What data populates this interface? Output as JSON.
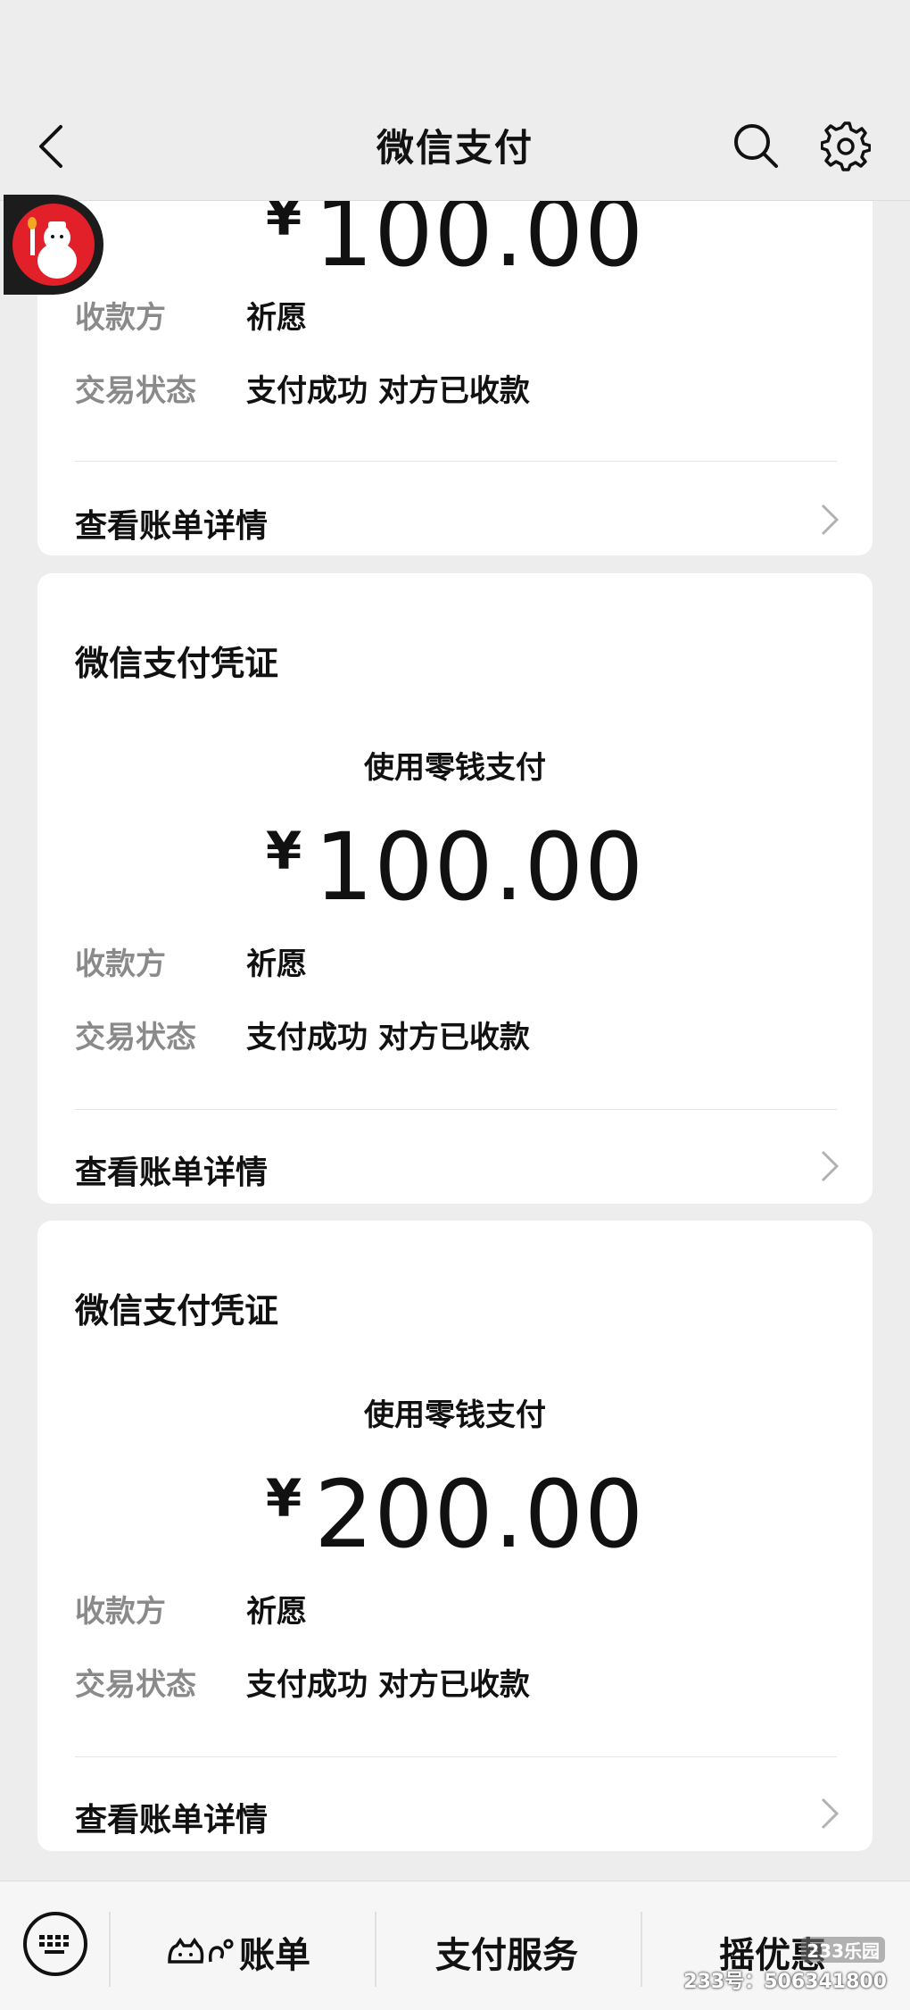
{
  "header": {
    "title": "微信支付"
  },
  "cards": [
    {
      "title": "",
      "method": "",
      "currency": "¥",
      "amount": "100.00",
      "payee_label": "收款方",
      "payee": "祈愿",
      "status_label": "交易状态",
      "status": "支付成功 对方已收款",
      "detail_label": "查看账单详情"
    },
    {
      "title": "微信支付凭证",
      "method": "使用零钱支付",
      "currency": "¥",
      "amount": "100.00",
      "payee_label": "收款方",
      "payee": "祈愿",
      "status_label": "交易状态",
      "status": "支付成功 对方已收款",
      "detail_label": "查看账单详情"
    },
    {
      "title": "微信支付凭证",
      "method": "使用零钱支付",
      "currency": "¥",
      "amount": "200.00",
      "payee_label": "收款方",
      "payee": "祈愿",
      "status_label": "交易状态",
      "status": "支付成功 对方已收款",
      "detail_label": "查看账单详情"
    }
  ],
  "bottom_bar": {
    "tabs": [
      "账单",
      "支付服务",
      "摇优惠"
    ]
  },
  "watermark": {
    "logo": "233乐园",
    "text": "233号：506341800"
  }
}
